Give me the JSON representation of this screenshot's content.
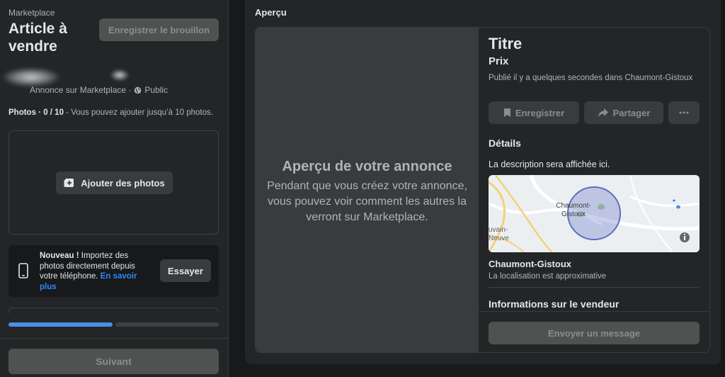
{
  "sidebar": {
    "breadcrumb": "Marketplace",
    "title": "Article à vendre",
    "save_draft_label": "Enregistrer le brouillon",
    "listing_meta": "Annonce sur Marketplace ·",
    "visibility": "Public",
    "photos_count": "Photos · 0 / 10",
    "photos_hint": " - Vous pouvez ajouter jusqu’à 10 photos.",
    "add_photos_label": "Ajouter des photos",
    "promo": {
      "new_label": "Nouveau !",
      "text": " Importez des photos directement depuis votre téléphone. ",
      "link": "En savoir plus",
      "try_label": "Essayer"
    },
    "progress": {
      "steps": 2,
      "current": 1
    },
    "next_label": "Suivant"
  },
  "preview": {
    "heading": "Aperçu",
    "image_title": "Aperçu de votre annonce",
    "image_subtitle": "Pendant que vous créez votre annonce, vous pouvez voir comment les autres la verront sur Marketplace.",
    "item_title": "Titre",
    "price": "Prix",
    "published": "Publié il y a quelques secondes dans Chaumont-Gistoux",
    "save_label": "Enregistrer",
    "share_label": "Partager",
    "details_heading": "Détails",
    "description": "La description sera affichée ici.",
    "map_label_line1": "Chaumont-",
    "map_label_line2": "Gistoux",
    "map_town_cut_line1": "uvain-",
    "map_town_cut_line2": "Neuve",
    "location": "Chaumont-Gistoux",
    "location_note": "La localisation est approximative",
    "seller_heading": "Informations sur le vendeur",
    "message_label": "Envoyer un message"
  },
  "colors": {
    "accent": "#2d88ff",
    "progress": "#4b8fe6",
    "panel": "#242526",
    "background": "#18191a"
  },
  "icons": [
    "globe-icon",
    "add-photo-icon",
    "phone-icon",
    "bookmark-icon",
    "share-icon",
    "more-icon",
    "info-icon"
  ]
}
